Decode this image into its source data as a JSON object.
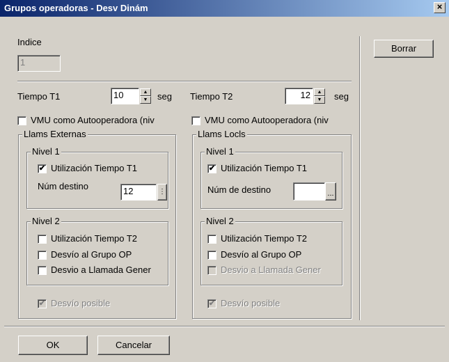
{
  "window": {
    "title": "Grupos operadoras - Desv Dinám",
    "close_glyph": "×"
  },
  "indice": {
    "label": "Indice",
    "value": "1"
  },
  "borrar_label": "Borrar",
  "t1": {
    "label": "Tiempo T1",
    "value": "10",
    "unit": "seg"
  },
  "t2": {
    "label": "Tiempo T2",
    "value": "12",
    "unit": "seg"
  },
  "vmu_left": {
    "label": "VMU como Autooperadora (niv",
    "checked": false
  },
  "vmu_right": {
    "label": "VMU como Autooperadora (niv",
    "checked": false
  },
  "externas": {
    "title": "Llams Externas",
    "nivel1": {
      "title": "Nivel 1",
      "util_t1": "Utilización Tiempo T1",
      "util_t1_checked": true,
      "num_label": "Núm destino",
      "num_value": "12"
    },
    "nivel2": {
      "title": "Nivel 2",
      "util_t2": "Utilización Tiempo T2",
      "desvio_grupo": "Desvío al Grupo OP",
      "desvio_llamada": "Desvio a Llamada Gener"
    },
    "desvio_posible": "Desvío posible"
  },
  "locals": {
    "title": "Llams Locls",
    "nivel1": {
      "title": "Nivel 1",
      "util_t1": "Utilización Tiempo T1",
      "util_t1_checked": true,
      "num_label": "Núm de destino",
      "num_value": ""
    },
    "nivel2": {
      "title": "Nivel 2",
      "util_t2": "Utilización Tiempo T2",
      "desvio_grupo": "Desvío al Grupo OP",
      "desvio_llamada": "Desvio a Llamada Gener"
    },
    "desvio_posible": "Desvío posible"
  },
  "footer": {
    "ok_label": "OK",
    "cancel_label": "Cancelar"
  },
  "glyphs": {
    "check": "✔",
    "up": "▲",
    "down": "▼",
    "ellipsis": "...",
    "picker": "⋮"
  }
}
